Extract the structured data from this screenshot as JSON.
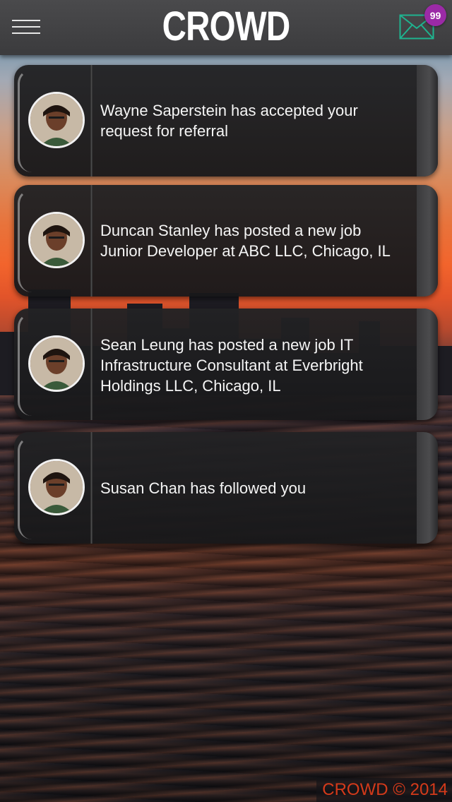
{
  "header": {
    "title": "CROWD",
    "menu_icon": "hamburger-menu-icon",
    "mail_icon": "envelope-icon",
    "mail_badge": "99",
    "mail_color": "#1fb38f",
    "badge_color": "#9b2aa6"
  },
  "notifications": [
    {
      "text_line1": "Wayne Saperstein has accepted your",
      "text_line2": "request for referral",
      "text_line3": "",
      "avatar": "user-avatar"
    },
    {
      "text_line1": "Duncan Stanley has posted a new job",
      "text_line2": "Junior Developer at ABC LLC, Chicago, IL",
      "text_line3": "",
      "avatar": "user-avatar"
    },
    {
      "text_line1": "Sean Leung has posted a new job IT",
      "text_line2": "Infrastructure Consultant at Everbright",
      "text_line3": "Holdings LLC, Chicago, IL",
      "avatar": "user-avatar"
    },
    {
      "text_line1": "Susan Chan has followed you",
      "text_line2": "",
      "text_line3": "",
      "avatar": "user-avatar"
    }
  ],
  "footer": {
    "copyright": "CROWD © 2014",
    "color": "#d43a1a"
  }
}
